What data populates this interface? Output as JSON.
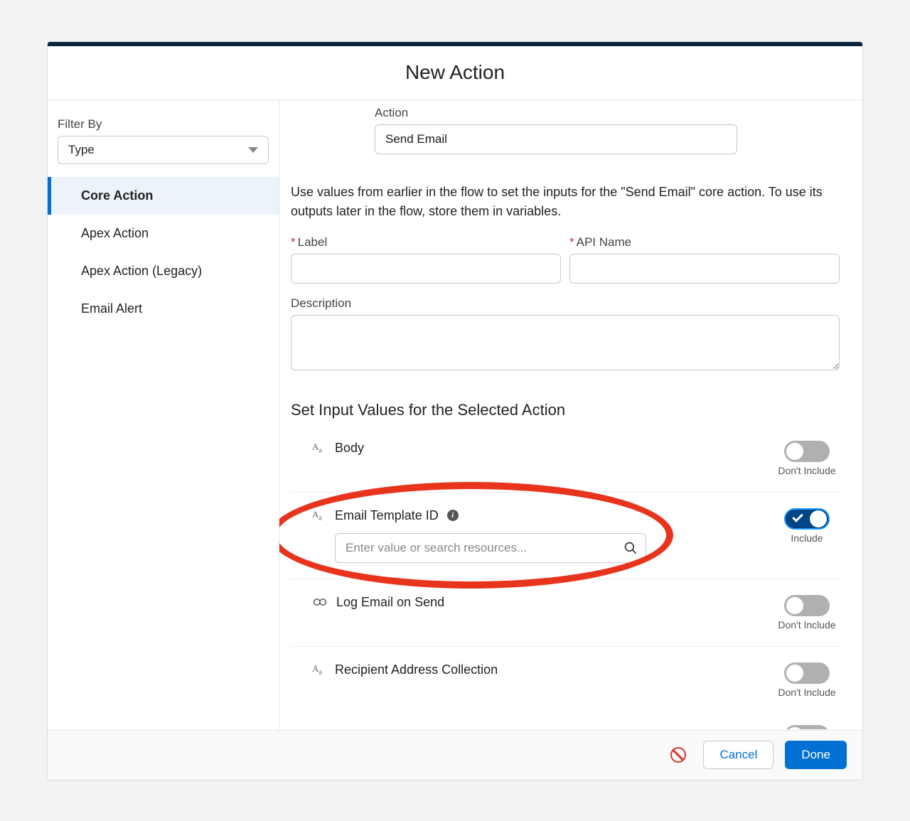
{
  "header": {
    "title": "New Action"
  },
  "sidebar": {
    "filter_label": "Filter By",
    "type_select_value": "Type",
    "items": [
      {
        "label": "Core Action",
        "active": true
      },
      {
        "label": "Apex Action",
        "active": false
      },
      {
        "label": "Apex Action (Legacy)",
        "active": false
      },
      {
        "label": "Email Alert",
        "active": false
      }
    ]
  },
  "main": {
    "action_label": "Action",
    "action_value": "Send Email",
    "help_text": "Use values from earlier in the flow to set the inputs for the \"Send Email\" core action. To use its outputs later in the flow, store them in variables.",
    "label_field_label": "Label",
    "api_name_field_label": "API Name",
    "description_label": "Description",
    "section_heading": "Set Input Values for the Selected Action",
    "inputs": [
      {
        "name": "Body",
        "type": "text",
        "included": false,
        "toggle_text": "Don't Include"
      },
      {
        "name": "Email Template ID",
        "type": "text",
        "has_info": true,
        "included": true,
        "toggle_text": "Include",
        "search_placeholder": "Enter value or search resources..."
      },
      {
        "name": "Log Email on Send",
        "type": "boolean",
        "included": false,
        "toggle_text": "Don't Include"
      },
      {
        "name": "Recipient Address Collection",
        "type": "text",
        "included": false,
        "toggle_text": "Don't Include"
      }
    ]
  },
  "footer": {
    "cancel_label": "Cancel",
    "done_label": "Done"
  }
}
